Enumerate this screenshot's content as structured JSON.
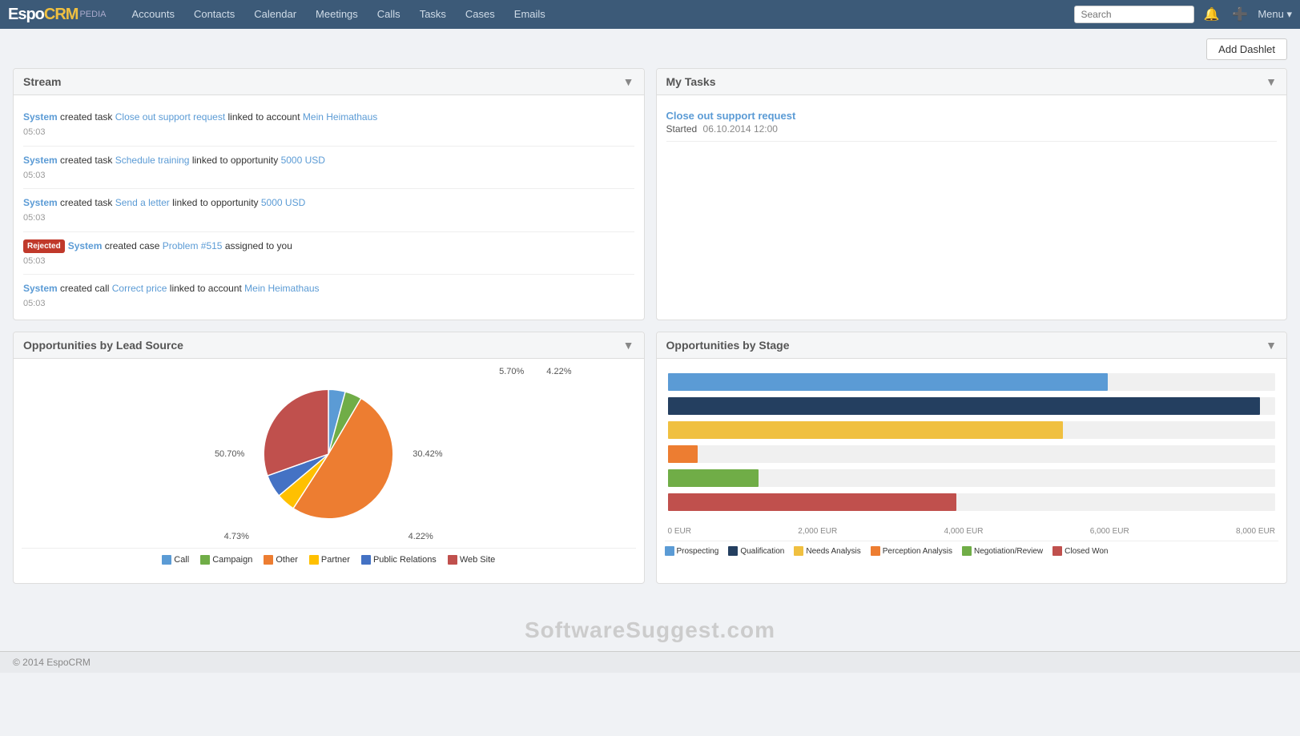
{
  "navbar": {
    "brand": "EspoCRM",
    "logo_crm": "CRM",
    "logo_pedia": "PEDIA",
    "links": [
      "Accounts",
      "Contacts",
      "Calendar",
      "Meetings",
      "Calls",
      "Tasks",
      "Cases",
      "Emails"
    ],
    "search_placeholder": "Search",
    "menu_label": "Menu ▾"
  },
  "toolbar": {
    "add_dashlet_label": "Add Dashlet"
  },
  "stream": {
    "title": "Stream",
    "items": [
      {
        "author": "System",
        "text1": " created task ",
        "link1": "Close out support request",
        "text2": " linked to account ",
        "link2": "Mein Heimathaus",
        "time": "05:03",
        "badge": null
      },
      {
        "author": "System",
        "text1": " created task ",
        "link1": "Schedule training",
        "text2": " linked to opportunity ",
        "link2": "5000 USD",
        "time": "05:03",
        "badge": null
      },
      {
        "author": "System",
        "text1": " created task ",
        "link1": "Send a letter",
        "text2": " linked to opportunity ",
        "link2": "5000 USD",
        "time": "05:03",
        "badge": null
      },
      {
        "author": "System",
        "text1": " created case ",
        "link1": "Problem #515",
        "text2": " assigned to you",
        "link2": null,
        "time": "05:03",
        "badge": "Rejected"
      },
      {
        "author": "System",
        "text1": " created call ",
        "link1": "Correct price",
        "text2": " linked to account ",
        "link2": "Mein Heimathaus",
        "time": "05:03",
        "badge": null
      }
    ]
  },
  "my_tasks": {
    "title": "My Tasks",
    "items": [
      {
        "name": "Close out support request",
        "date_label": "Started",
        "date": "06.10.2014 12:00"
      }
    ]
  },
  "opp_by_lead": {
    "title": "Opportunities by Lead Source",
    "slices": [
      {
        "label": "Call",
        "pct": 4.22,
        "color": "#5b9bd5",
        "startAngle": 0
      },
      {
        "label": "Campaign",
        "pct": 4.22,
        "color": "#70ad47",
        "startAngle": 15.19
      },
      {
        "label": "Other",
        "pct": 50.7,
        "color": "#ed7d31",
        "startAngle": 30.38
      },
      {
        "label": "Partner",
        "pct": 4.73,
        "color": "#ffc000",
        "startAngle": 212.9
      },
      {
        "label": "Public Relations",
        "pct": 5.7,
        "color": "#4472c4",
        "startAngle": 229.93
      },
      {
        "label": "Web Site",
        "pct": 30.42,
        "color": "#c0504d",
        "startAngle": 250.45
      }
    ],
    "labels_right": [
      "5.70%",
      "4.22%"
    ],
    "label_left": "50.70%",
    "label_bottom_left": "4.73%",
    "label_bottom_mid": "4.22%",
    "label_right_mid": "30.42%",
    "legend": [
      {
        "label": "Call",
        "color": "#5b9bd5"
      },
      {
        "label": "Campaign",
        "color": "#70ad47"
      },
      {
        "label": "Other",
        "color": "#ed7d31"
      },
      {
        "label": "Partner",
        "color": "#ffc000"
      },
      {
        "label": "Public Relations",
        "color": "#4472c4"
      },
      {
        "label": "Web Site",
        "color": "#c0504d"
      }
    ]
  },
  "opp_by_stage": {
    "title": "Opportunities by Stage",
    "max_value": 8000,
    "axis_labels": [
      "0 EUR",
      "2,000 EUR",
      "4,000 EUR",
      "6,000 EUR",
      "8,000 EUR"
    ],
    "bars": [
      {
        "label": "Prospecting",
        "value": 5800,
        "color": "#5b9bd5",
        "max": 8000
      },
      {
        "label": "Qualification",
        "value": 7800,
        "color": "#243f60",
        "max": 8000
      },
      {
        "label": "Needs Analysis",
        "value": 5200,
        "color": "#f0c040",
        "max": 8000
      },
      {
        "label": "Perception Analysis",
        "value": 400,
        "color": "#ed7d31",
        "max": 8000
      },
      {
        "label": "Negotiation/Review",
        "value": 1200,
        "color": "#70ad47",
        "max": 8000
      },
      {
        "label": "Closed Won",
        "value": 3800,
        "color": "#c0504d",
        "max": 8000
      }
    ],
    "legend": [
      {
        "label": "Prospecting",
        "color": "#5b9bd5"
      },
      {
        "label": "Qualification",
        "color": "#243f60"
      },
      {
        "label": "Needs Analysis",
        "color": "#f0c040"
      },
      {
        "label": "Perception Analysis",
        "color": "#ed7d31"
      },
      {
        "label": "Negotiation/Review",
        "color": "#70ad47"
      },
      {
        "label": "Closed Won",
        "color": "#c0504d"
      }
    ]
  },
  "watermark": {
    "text_normal": "Software",
    "text_bold": "Suggest",
    "text_suffix": ".com"
  },
  "footer": {
    "copyright": "© 2014 EspoCRM"
  }
}
